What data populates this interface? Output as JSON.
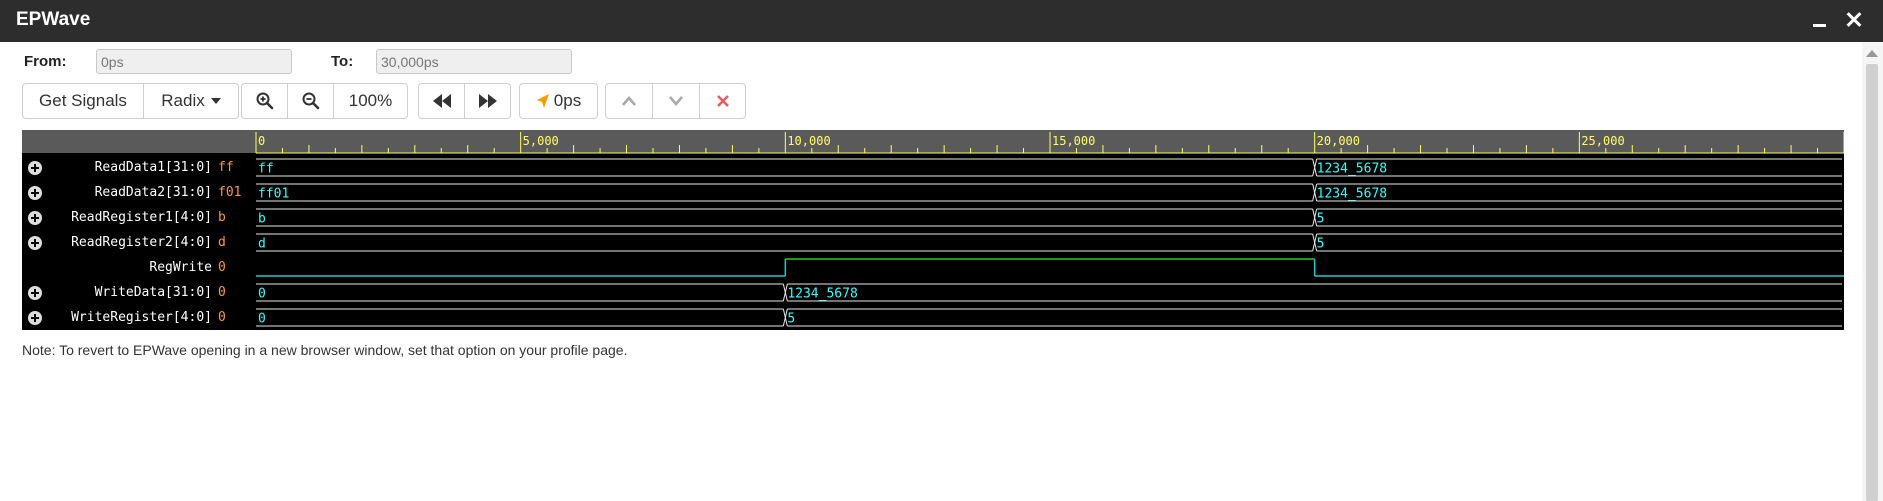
{
  "window": {
    "title": "EPWave"
  },
  "range": {
    "from_label": "From:",
    "from_value": "0ps",
    "to_label": "To:",
    "to_value": "30,000ps"
  },
  "toolbar": {
    "get_signals": "Get Signals",
    "radix": "Radix",
    "zoom_level": "100%",
    "cursor_time": "0ps"
  },
  "timeline": {
    "start": 0,
    "end": 30000,
    "unit": "ps",
    "tick_labels": [
      "0",
      "5,000",
      "10,000",
      "15,000",
      "20,000",
      "25,000"
    ]
  },
  "signals": [
    {
      "name": "ReadData1[31:0]",
      "value": "ff",
      "type": "bus",
      "expandable": true,
      "segments": [
        {
          "t": 0,
          "label": "ff"
        },
        {
          "t": 20000,
          "label": "1234_5678"
        }
      ]
    },
    {
      "name": "ReadData2[31:0]",
      "value": "f01",
      "type": "bus",
      "expandable": true,
      "segments": [
        {
          "t": 0,
          "label": "ff01"
        },
        {
          "t": 20000,
          "label": "1234_5678"
        }
      ]
    },
    {
      "name": "ReadRegister1[4:0]",
      "value": "b",
      "type": "bus",
      "expandable": true,
      "segments": [
        {
          "t": 0,
          "label": "b"
        },
        {
          "t": 20000,
          "label": "5"
        }
      ]
    },
    {
      "name": "ReadRegister2[4:0]",
      "value": "d",
      "type": "bus",
      "expandable": true,
      "segments": [
        {
          "t": 0,
          "label": "d"
        },
        {
          "t": 20000,
          "label": "5"
        }
      ]
    },
    {
      "name": "RegWrite",
      "value": "0",
      "type": "bit",
      "expandable": false,
      "levels": [
        {
          "t": 0,
          "v": 0
        },
        {
          "t": 10000,
          "v": 1
        },
        {
          "t": 20000,
          "v": 0
        }
      ]
    },
    {
      "name": "WriteData[31:0]",
      "value": "0",
      "type": "bus",
      "expandable": true,
      "segments": [
        {
          "t": 0,
          "label": "0"
        },
        {
          "t": 10000,
          "label": "1234_5678"
        }
      ]
    },
    {
      "name": "WriteRegister[4:0]",
      "value": "0",
      "type": "bus",
      "expandable": true,
      "segments": [
        {
          "t": 0,
          "label": "0"
        },
        {
          "t": 10000,
          "label": "5"
        }
      ]
    }
  ],
  "colors": {
    "background": "#000000",
    "bus": "#e8e8e8",
    "bus_text": "#33ffff",
    "bit_high": "#22cc22",
    "bit_low": "#22cccc",
    "ruler": "#5a5a5a",
    "tick": "#ffff66",
    "signal_value": "#ff9933"
  },
  "note": "Note: To revert to EPWave opening in a new browser window, set that option on your profile page."
}
